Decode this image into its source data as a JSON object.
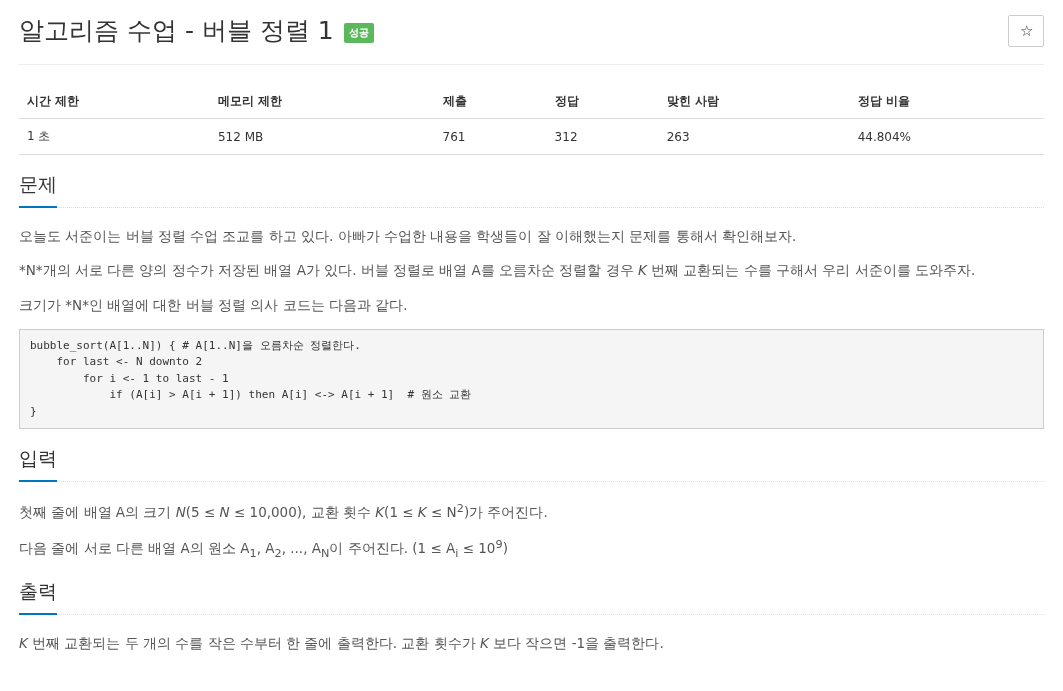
{
  "title": "알고리즘 수업 - 버블 정렬 1",
  "badge": "성공",
  "star": "☆",
  "stats": {
    "columns": [
      "시간 제한",
      "메모리 제한",
      "제출",
      "정답",
      "맞힌 사람",
      "정답 비율"
    ],
    "row": [
      "1 초",
      "512 MB",
      "761",
      "312",
      "263",
      "44.804%"
    ]
  },
  "sections": [
    {
      "title": "문제",
      "paragraphs": [
        "오늘도 서준이는 버블 정렬 수업 조교를 하고 있다. 아빠가 수업한 내용을 학생들이 잘 이해했는지 문제를 통해서 확인해보자.",
        "*N*개의 서로 다른 양의 정수가 저장된 배열 A가 있다. 버블 정렬로 배열 A를 오름차순 정렬할 경우 *K* 번째 교환되는 수를 구해서 우리 서준이를 도와주자.",
        "크기가 *N*인 배열에 대한 버블 정렬 의사 코드는 다음과 같다."
      ],
      "code": "bubble_sort(A[1..N]) { # A[1..N]을 오름차순 정렬한다.\n    for last <- N downto 2\n        for i <- 1 to last - 1\n            if (A[i] > A[i + 1]) then A[i] <-> A[i + 1]  # 원소 교환\n}"
    },
    {
      "title": "입력",
      "paragraphs": [
        "첫째 줄에 배열 A의 크기 *N*(5 ≤ *N* ≤ 10,000), 교환 횟수 *K*(1 ≤ *K* ≤ N$^{2}$)가 주어진다.",
        "다음 줄에 서로 다른 배열 A의 원소 A$_{1}$, A$_{2}$, ..., A$_{N}$이 주어진다. (1 ≤ A$_{i}$ ≤ 10$^{9}$)"
      ]
    },
    {
      "title": "출력",
      "paragraphs": [
        "*K* 번째 교환되는 두 개의 수를 작은 수부터 한 줄에 출력한다. 교환 횟수가 *K* 보다 작으면 -1을 출력한다."
      ]
    }
  ]
}
